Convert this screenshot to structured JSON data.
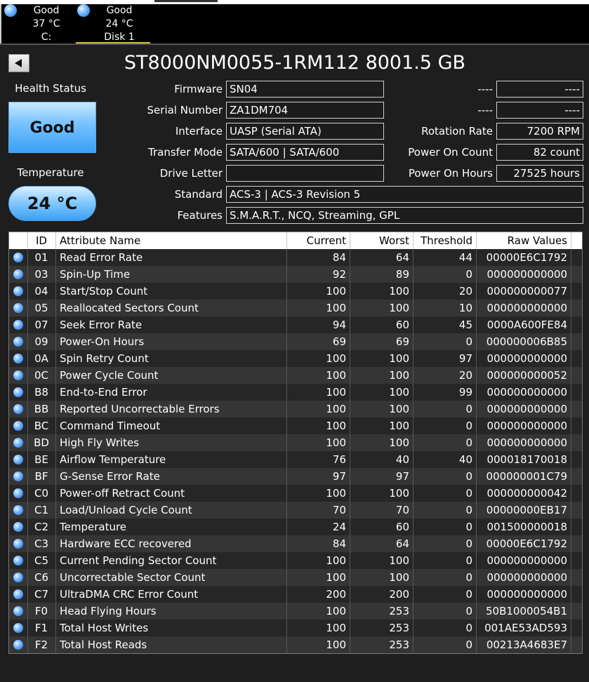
{
  "drives": [
    {
      "status": "Good",
      "temp": "37 °C",
      "name": "C:"
    },
    {
      "status": "Good",
      "temp": "24 °C",
      "name": "Disk 1"
    }
  ],
  "title": "ST8000NM0055-1RM112 8001.5 GB",
  "health": {
    "label": "Health Status",
    "value": "Good"
  },
  "temperature": {
    "label": "Temperature",
    "value": "24 °C"
  },
  "info": {
    "firmware_label": "Firmware",
    "firmware": "SN04",
    "serial_label": "Serial Number",
    "serial": "ZA1DM704",
    "interface_label": "Interface",
    "interface": "UASP (Serial ATA)",
    "transfer_label": "Transfer Mode",
    "transfer": "SATA/600 | SATA/600",
    "drive_letter_label": "Drive Letter",
    "drive_letter": "",
    "standard_label": "Standard",
    "standard": "ACS-3 | ACS-3 Revision 5",
    "features_label": "Features",
    "features": "S.M.A.R.T., NCQ, Streaming, GPL",
    "blank1_label": "----",
    "blank1": "----",
    "blank2_label": "----",
    "blank2": "----",
    "rotation_label": "Rotation Rate",
    "rotation": "7200 RPM",
    "power_count_label": "Power On Count",
    "power_count": "82 count",
    "power_hours_label": "Power On Hours",
    "power_hours": "27525 hours"
  },
  "table": {
    "headers": {
      "id": "ID",
      "name": "Attribute Name",
      "current": "Current",
      "worst": "Worst",
      "threshold": "Threshold",
      "raw": "Raw Values"
    },
    "rows": [
      {
        "id": "01",
        "name": "Read Error Rate",
        "current": "84",
        "worst": "64",
        "threshold": "44",
        "raw": "00000E6C1792"
      },
      {
        "id": "03",
        "name": "Spin-Up Time",
        "current": "92",
        "worst": "89",
        "threshold": "0",
        "raw": "000000000000"
      },
      {
        "id": "04",
        "name": "Start/Stop Count",
        "current": "100",
        "worst": "100",
        "threshold": "20",
        "raw": "000000000077"
      },
      {
        "id": "05",
        "name": "Reallocated Sectors Count",
        "current": "100",
        "worst": "100",
        "threshold": "10",
        "raw": "000000000000"
      },
      {
        "id": "07",
        "name": "Seek Error Rate",
        "current": "94",
        "worst": "60",
        "threshold": "45",
        "raw": "0000A600FE84"
      },
      {
        "id": "09",
        "name": "Power-On Hours",
        "current": "69",
        "worst": "69",
        "threshold": "0",
        "raw": "000000006B85"
      },
      {
        "id": "0A",
        "name": "Spin Retry Count",
        "current": "100",
        "worst": "100",
        "threshold": "97",
        "raw": "000000000000"
      },
      {
        "id": "0C",
        "name": "Power Cycle Count",
        "current": "100",
        "worst": "100",
        "threshold": "20",
        "raw": "000000000052"
      },
      {
        "id": "B8",
        "name": "End-to-End Error",
        "current": "100",
        "worst": "100",
        "threshold": "99",
        "raw": "000000000000"
      },
      {
        "id": "BB",
        "name": "Reported Uncorrectable Errors",
        "current": "100",
        "worst": "100",
        "threshold": "0",
        "raw": "000000000000"
      },
      {
        "id": "BC",
        "name": "Command Timeout",
        "current": "100",
        "worst": "100",
        "threshold": "0",
        "raw": "000000000000"
      },
      {
        "id": "BD",
        "name": "High Fly Writes",
        "current": "100",
        "worst": "100",
        "threshold": "0",
        "raw": "000000000000"
      },
      {
        "id": "BE",
        "name": "Airflow Temperature",
        "current": "76",
        "worst": "40",
        "threshold": "40",
        "raw": "000018170018"
      },
      {
        "id": "BF",
        "name": "G-Sense Error Rate",
        "current": "97",
        "worst": "97",
        "threshold": "0",
        "raw": "000000001C79"
      },
      {
        "id": "C0",
        "name": "Power-off Retract Count",
        "current": "100",
        "worst": "100",
        "threshold": "0",
        "raw": "000000000042"
      },
      {
        "id": "C1",
        "name": "Load/Unload Cycle Count",
        "current": "70",
        "worst": "70",
        "threshold": "0",
        "raw": "00000000EB17"
      },
      {
        "id": "C2",
        "name": "Temperature",
        "current": "24",
        "worst": "60",
        "threshold": "0",
        "raw": "001500000018"
      },
      {
        "id": "C3",
        "name": "Hardware ECC recovered",
        "current": "84",
        "worst": "64",
        "threshold": "0",
        "raw": "00000E6C1792"
      },
      {
        "id": "C5",
        "name": "Current Pending Sector Count",
        "current": "100",
        "worst": "100",
        "threshold": "0",
        "raw": "000000000000"
      },
      {
        "id": "C6",
        "name": "Uncorrectable Sector Count",
        "current": "100",
        "worst": "100",
        "threshold": "0",
        "raw": "000000000000"
      },
      {
        "id": "C7",
        "name": "UltraDMA CRC Error Count",
        "current": "200",
        "worst": "200",
        "threshold": "0",
        "raw": "000000000000"
      },
      {
        "id": "F0",
        "name": "Head Flying Hours",
        "current": "100",
        "worst": "253",
        "threshold": "0",
        "raw": "50B1000054B1"
      },
      {
        "id": "F1",
        "name": "Total Host Writes",
        "current": "100",
        "worst": "253",
        "threshold": "0",
        "raw": "001AE53AD593"
      },
      {
        "id": "F2",
        "name": "Total Host Reads",
        "current": "100",
        "worst": "253",
        "threshold": "0",
        "raw": "00213A4683E7"
      }
    ]
  }
}
